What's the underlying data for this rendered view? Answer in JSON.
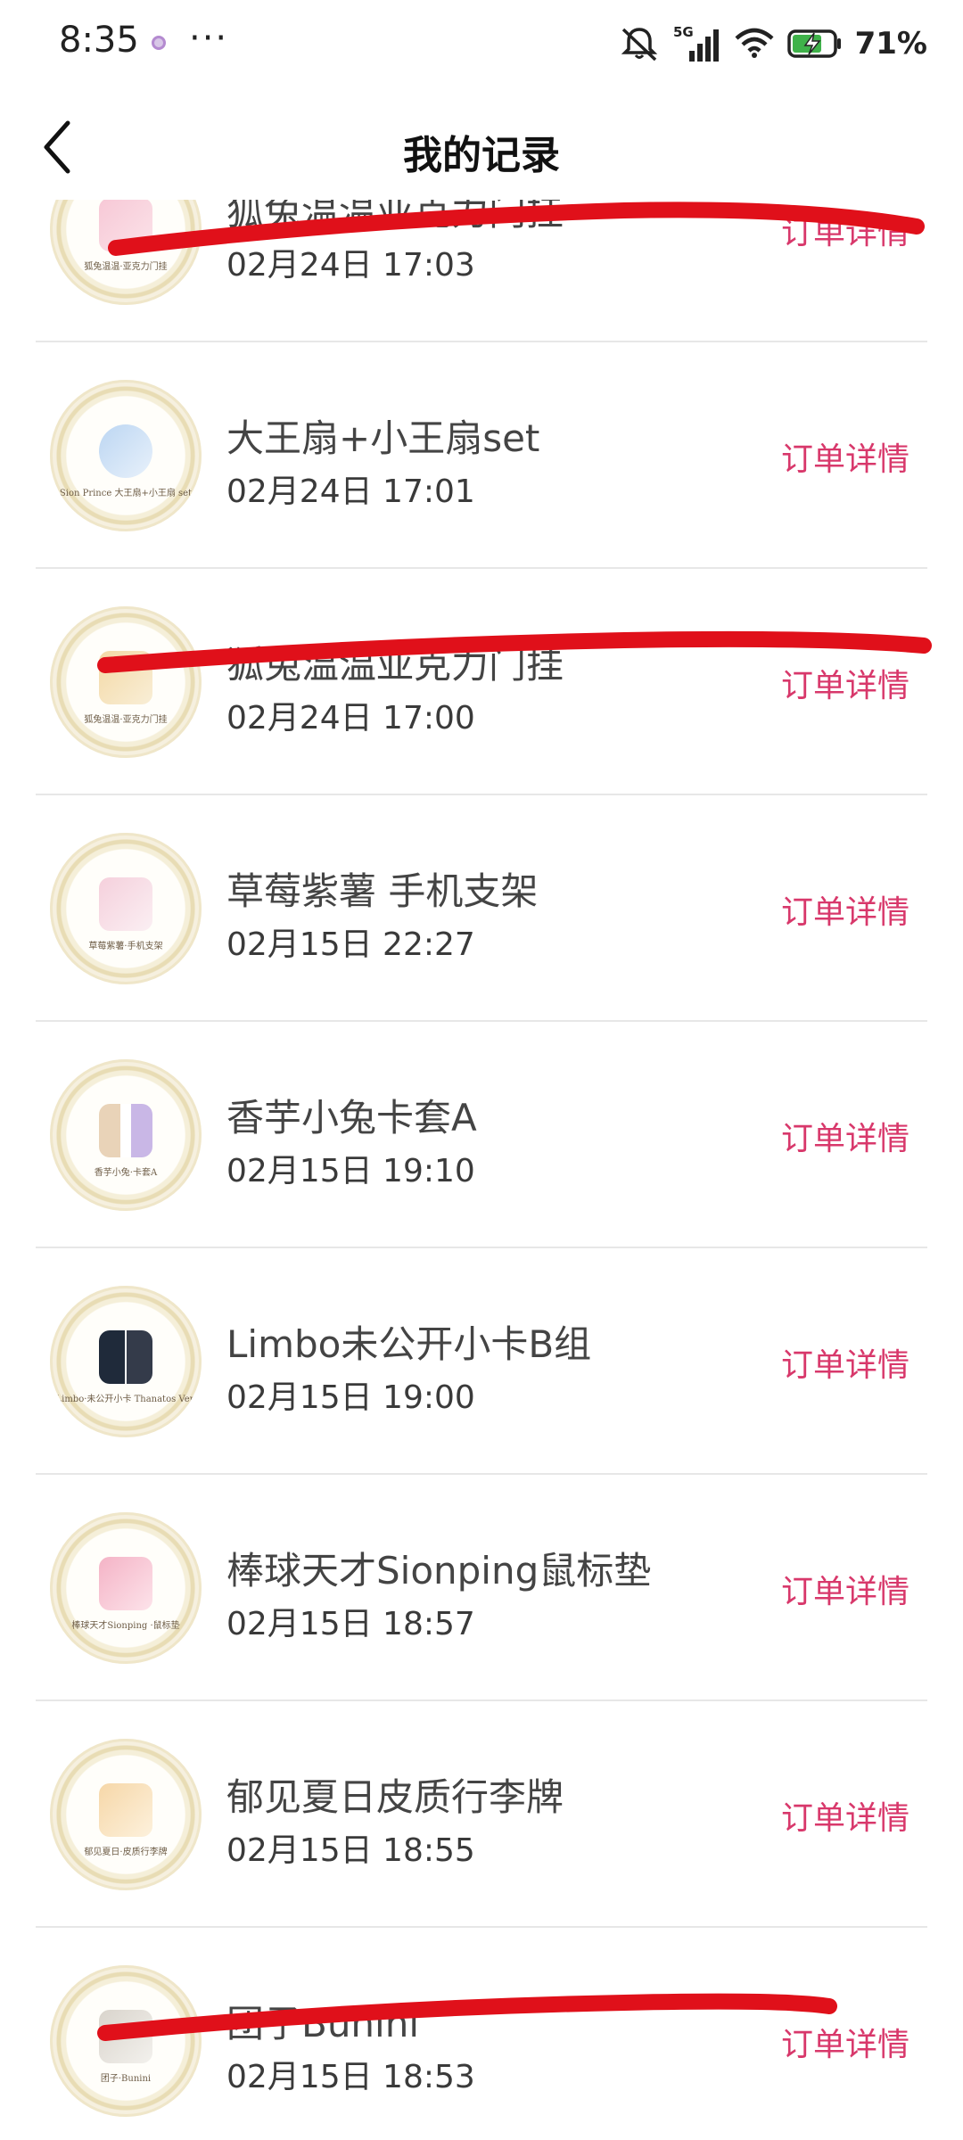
{
  "status_bar": {
    "time": "8:35",
    "more": "···",
    "network": "5G",
    "battery": "71%"
  },
  "header": {
    "title": "我的记录"
  },
  "detail_label": "订单详情",
  "records": [
    {
      "name": "狐兔温温亚克力门挂",
      "date": "02月24日 17:03",
      "label": "狐兔温温·亚克力门挂"
    },
    {
      "name": "大王扇+小王扇set",
      "date": "02月24日 17:01",
      "label": "Sion Prince 大王扇+小王扇 set"
    },
    {
      "name": "狐兔温温亚克力门挂",
      "date": "02月24日 17:00",
      "label": "狐兔温温·亚克力门挂"
    },
    {
      "name": "草莓紫薯 手机支架",
      "date": "02月15日 22:27",
      "label": "草莓紫薯·手机支架"
    },
    {
      "name": "香芋小兔卡套A",
      "date": "02月15日 19:10",
      "label": "香芋小兔·卡套A"
    },
    {
      "name": "Limbo未公开小卡B组",
      "date": "02月15日 19:00",
      "label": "Limbo·未公开小卡 Thanatos Ver."
    },
    {
      "name": "棒球天才Sionping鼠标垫",
      "date": "02月15日 18:57",
      "label": "棒球天才Sionping ·鼠标垫"
    },
    {
      "name": "郁见夏日皮质行李牌",
      "date": "02月15日 18:55",
      "label": "郁见夏日·皮质行李牌"
    },
    {
      "name": "团子Bunini",
      "date": "02月15日 18:53",
      "label": "团子·Bunini"
    }
  ],
  "colors": {
    "accent": "#d8386b",
    "scribble": "#e0101a",
    "divider": "#e7e7e7"
  }
}
